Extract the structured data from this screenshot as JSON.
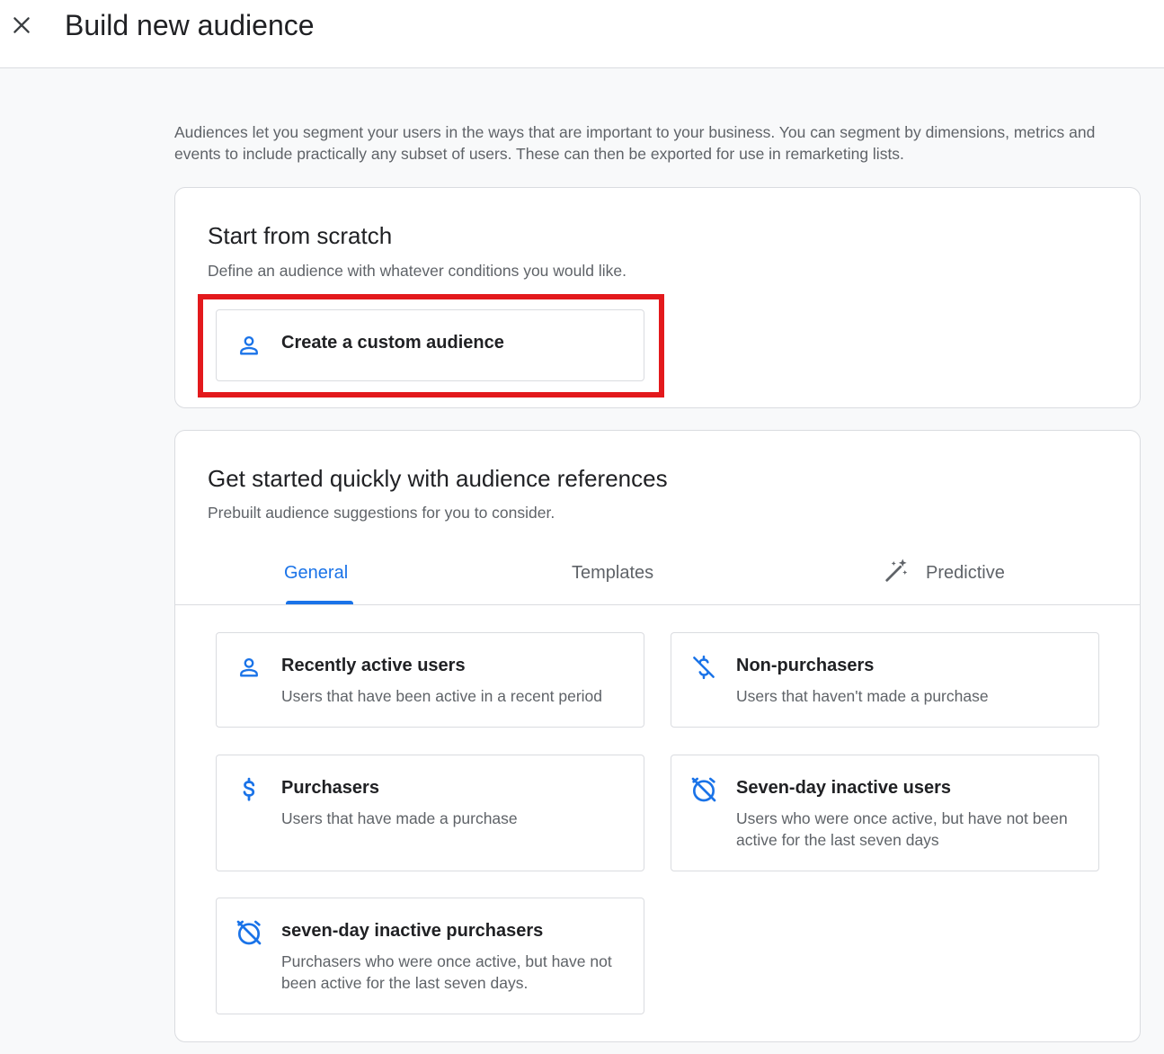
{
  "header": {
    "title": "Build new audience",
    "close_icon": "close-icon"
  },
  "intro_text": "Audiences let you segment your users in the ways that are important to your business. You can segment by dimensions, metrics and events to include practically any subset of users. These can then be exported for use in remarketing lists.",
  "scratch": {
    "title": "Start from scratch",
    "subtitle": "Define an audience with whatever conditions you would like.",
    "create_button": {
      "label": "Create a custom audience",
      "icon": "person-icon"
    }
  },
  "references": {
    "title": "Get started quickly with audience references",
    "subtitle": "Prebuilt audience suggestions for you to consider.",
    "tabs": [
      {
        "label": "General",
        "active": true
      },
      {
        "label": "Templates",
        "active": false
      },
      {
        "label": "Predictive",
        "active": false,
        "icon": "magic-wand-icon"
      }
    ],
    "options": [
      {
        "title": "Recently active users",
        "description": "Users that have been active in a recent period",
        "icon": "person-icon"
      },
      {
        "title": "Non-purchasers",
        "description": "Users that haven't made a purchase",
        "icon": "money-off-icon"
      },
      {
        "title": "Purchasers",
        "description": "Users that have made a purchase",
        "icon": "dollar-icon"
      },
      {
        "title": "Seven-day inactive users",
        "description": "Users who were once active, but have not been active for the last seven days",
        "icon": "timer-off-icon"
      },
      {
        "title": "seven-day inactive purchasers",
        "description": "Purchasers who were once active, but have not been active for the last seven days.",
        "icon": "timer-off-icon"
      }
    ]
  },
  "colors": {
    "accent": "#1a73e8",
    "highlight": "#e3191c",
    "background": "#f8f9fa"
  }
}
